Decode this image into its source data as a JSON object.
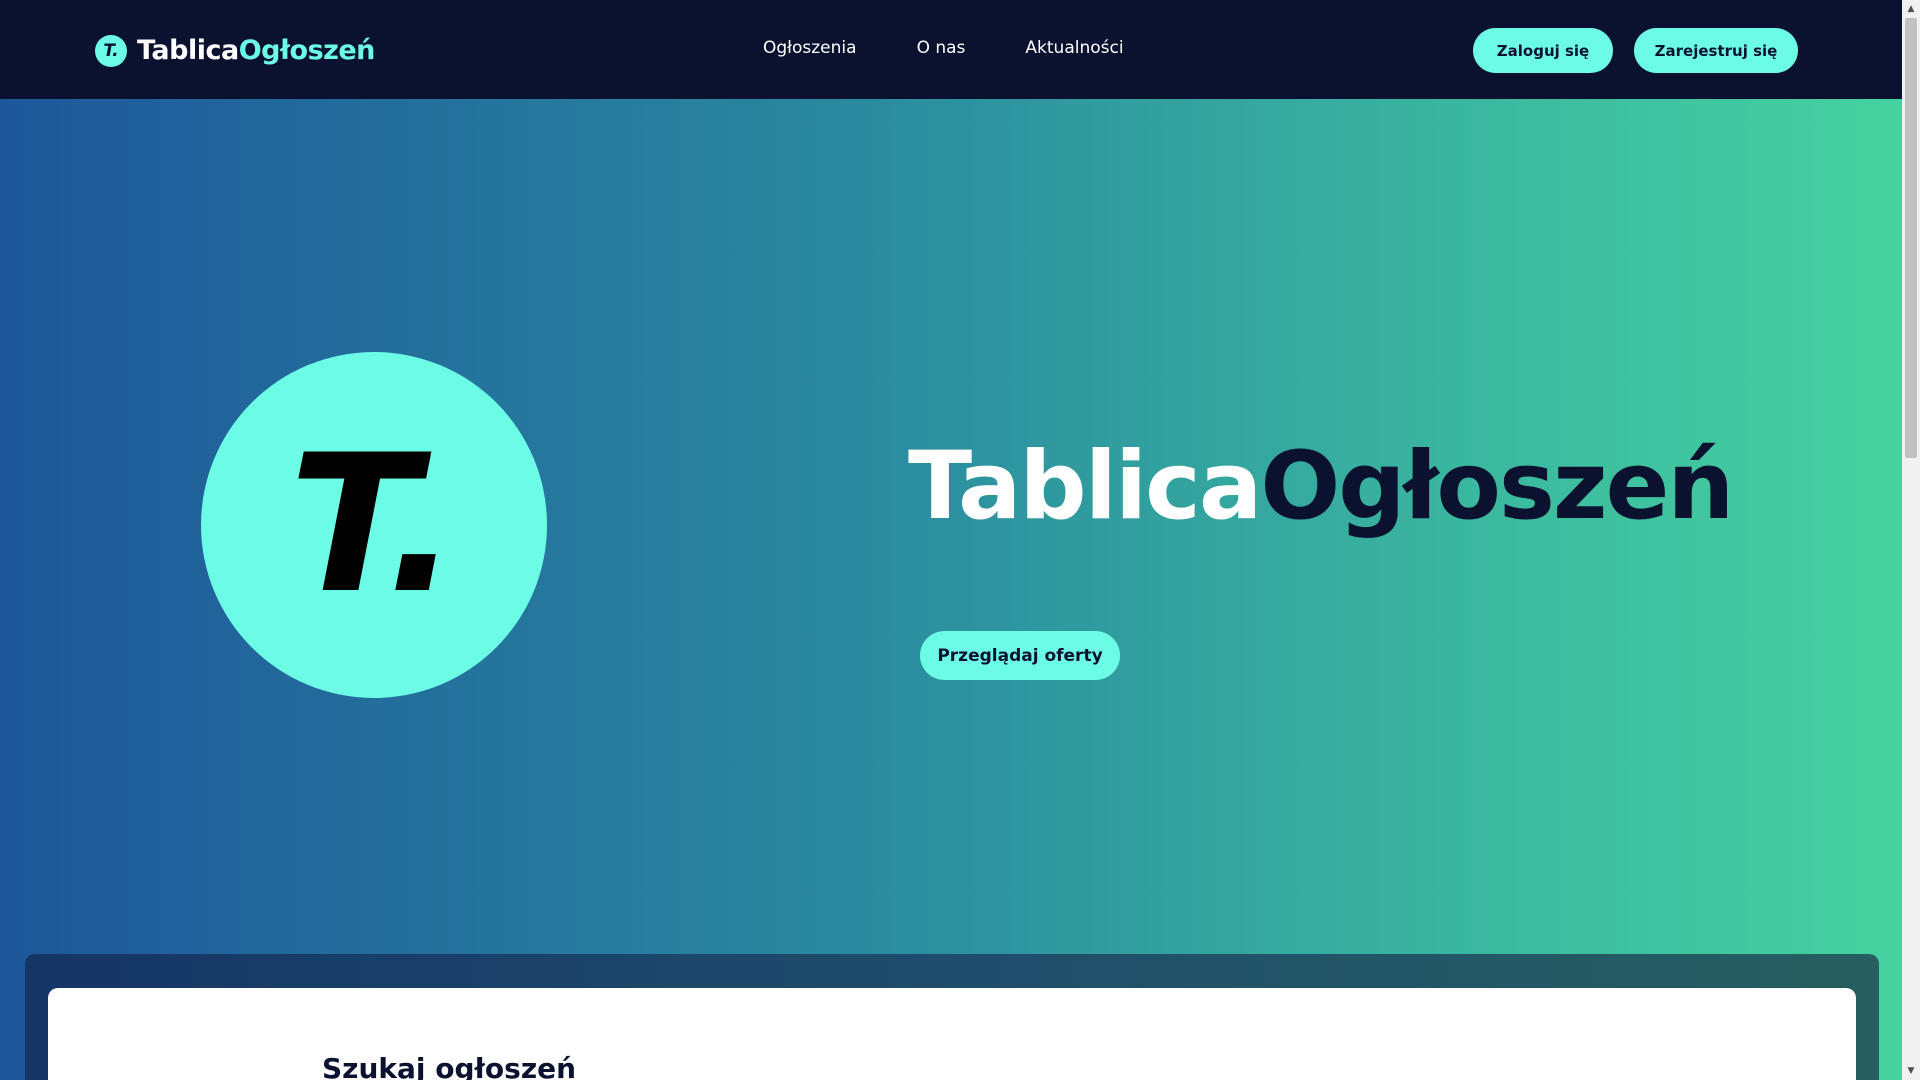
{
  "brand": {
    "mark": "T.",
    "name_part1": "Tablica",
    "name_part2": "Ogłoszeń"
  },
  "nav": {
    "links": [
      "Ogłoszenia",
      "O nas",
      "Aktualności"
    ],
    "login_label": "Zaloguj się",
    "register_label": "Zarejestruj się"
  },
  "hero": {
    "logo_mark": "T.",
    "title_part1": "Tablica",
    "title_part2": "Ogłoszeń",
    "cta_label": "Przeglądaj oferty"
  },
  "search": {
    "heading": "Szukaj ogłoszeń",
    "dots": "• • • •"
  },
  "icons": {
    "scroll_up": "triangle-up",
    "scroll_down": "triangle-down"
  },
  "colors": {
    "navbar_bg": "#0b1230",
    "accent": "#6cfce6",
    "gradient_start": "#1d579a",
    "gradient_end": "#46d2a0"
  }
}
